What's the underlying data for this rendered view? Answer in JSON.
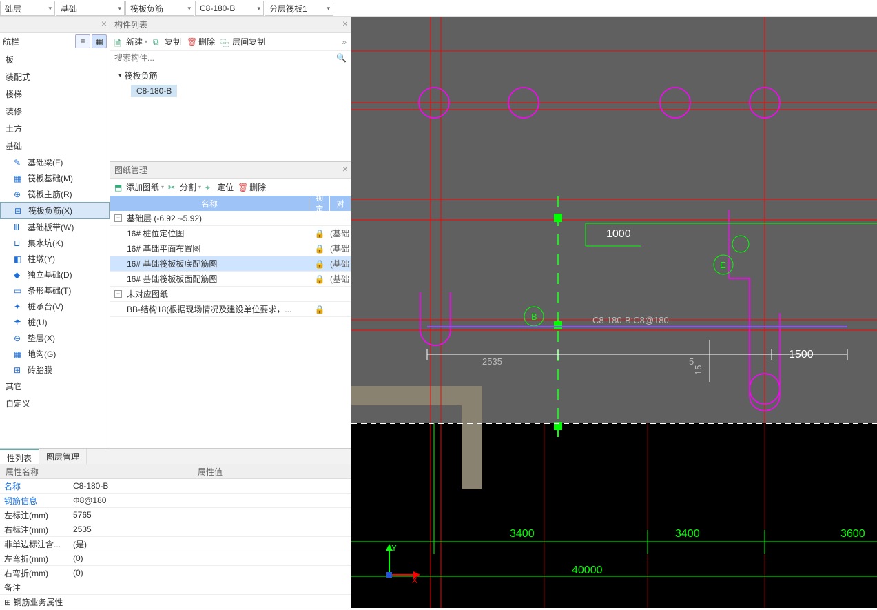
{
  "top": {
    "dd1": "础层",
    "dd2": "基础",
    "dd3": "筏板负筋",
    "dd4": "C8-180-B",
    "dd5": "分层筏板1"
  },
  "nav": {
    "title": "航栏",
    "cats": [
      "板",
      "装配式",
      "楼梯",
      "装修",
      "土方",
      "基础"
    ],
    "foundation_items": [
      "基础梁(F)",
      "筏板基础(M)",
      "筏板主筋(R)",
      "筏板负筋(X)",
      "基础板带(W)",
      "集水坑(K)",
      "柱墩(Y)",
      "独立基础(D)",
      "条形基础(T)",
      "桩承台(V)",
      "桩(U)",
      "垫层(X)",
      "地沟(G)",
      "砖胎膜"
    ],
    "tail_cats": [
      "其它",
      "自定义"
    ]
  },
  "comp": {
    "title": "构件列表",
    "btn_new": "新建",
    "btn_copy": "复制",
    "btn_del": "删除",
    "btn_layercopy": "层间复制",
    "search_ph": "搜索构件...",
    "parent": "筏板负筋",
    "child": "C8-180-B"
  },
  "dm": {
    "title": "图纸管理",
    "btn_add": "添加图纸",
    "btn_split": "分割",
    "btn_locate": "定位",
    "btn_del": "删除",
    "th_name": "名称",
    "th_lock": "锁定",
    "th_ext": "对",
    "rows": [
      {
        "type": "group",
        "label": "基础层 (-6.92~-5.92)",
        "indent": 0
      },
      {
        "type": "leaf",
        "label": "16# 桩位定位图",
        "lock": true,
        "ext": "(基础",
        "indent": 1
      },
      {
        "type": "leaf",
        "label": "16# 基础平面布置图",
        "lock": true,
        "ext": "(基础",
        "indent": 1
      },
      {
        "type": "leaf",
        "label": "16# 基础筏板板底配筋图",
        "lock": true,
        "ext": "(基础",
        "indent": 1,
        "selected": true
      },
      {
        "type": "leaf",
        "label": "16# 基础筏板板面配筋图",
        "lock": true,
        "ext": "(基础",
        "indent": 1
      },
      {
        "type": "group",
        "label": "未对应图纸",
        "indent": 0
      },
      {
        "type": "leaf",
        "label": "BB-结构18(根据现场情况及建设单位要求，...",
        "lock": true,
        "ext": "",
        "indent": 1
      }
    ]
  },
  "prop": {
    "tab1": "性列表",
    "tab2": "图层管理",
    "th_name": "属性名称",
    "th_val": "属性值",
    "rows": [
      {
        "name": "名称",
        "val": "C8-180-B",
        "blue": true
      },
      {
        "name": "钢筋信息",
        "val": "Φ8@180",
        "blue": true
      },
      {
        "name": "左标注(mm)",
        "val": "5765"
      },
      {
        "name": "右标注(mm)",
        "val": "2535"
      },
      {
        "name": "非单边标注含...",
        "val": "(是)"
      },
      {
        "name": "左弯折(mm)",
        "val": "(0)"
      },
      {
        "name": "右弯折(mm)",
        "val": "(0)"
      },
      {
        "name": "备注",
        "val": ""
      },
      {
        "name": "钢筋业务属性",
        "val": "",
        "expand": true
      }
    ]
  },
  "canvas": {
    "label_1000": "1000",
    "label_1500": "1500",
    "label_2535": "2535",
    "label_5": "5",
    "label_15": "15",
    "el_name": "C8-180-B:C8@180",
    "grid1": "3400",
    "grid2": "3400",
    "grid3": "3600",
    "total": "40000",
    "axis_b": "B",
    "axis_e": "E",
    "axis_x": "X",
    "axis_y": "Y"
  }
}
